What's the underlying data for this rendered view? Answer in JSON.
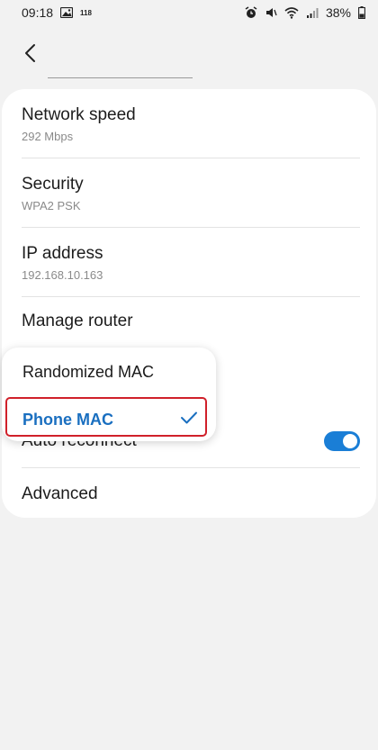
{
  "status_bar": {
    "time": "09:18",
    "notif_count": "118",
    "battery": "38%",
    "icons": [
      "gallery-icon",
      "alarm-icon",
      "mute-icon",
      "wifi-icon",
      "signal-icon"
    ]
  },
  "settings": {
    "network_speed": {
      "label": "Network speed",
      "value": "292 Mbps"
    },
    "security": {
      "label": "Security",
      "value": "WPA2 PSK"
    },
    "ip_address": {
      "label": "IP address",
      "value": "192.168.10.163"
    },
    "manage_router": {
      "label": "Manage router"
    },
    "auto_reconnect": {
      "label": "Auto reconnect",
      "enabled": true
    },
    "advanced": {
      "label": "Advanced"
    }
  },
  "mac_popup": {
    "options": [
      "Randomized MAC",
      "Phone MAC"
    ],
    "selected": "Phone MAC"
  },
  "colors": {
    "accent": "#1a7ed6",
    "selected_text": "#1a6fc0",
    "highlight_border": "#d0202a"
  }
}
